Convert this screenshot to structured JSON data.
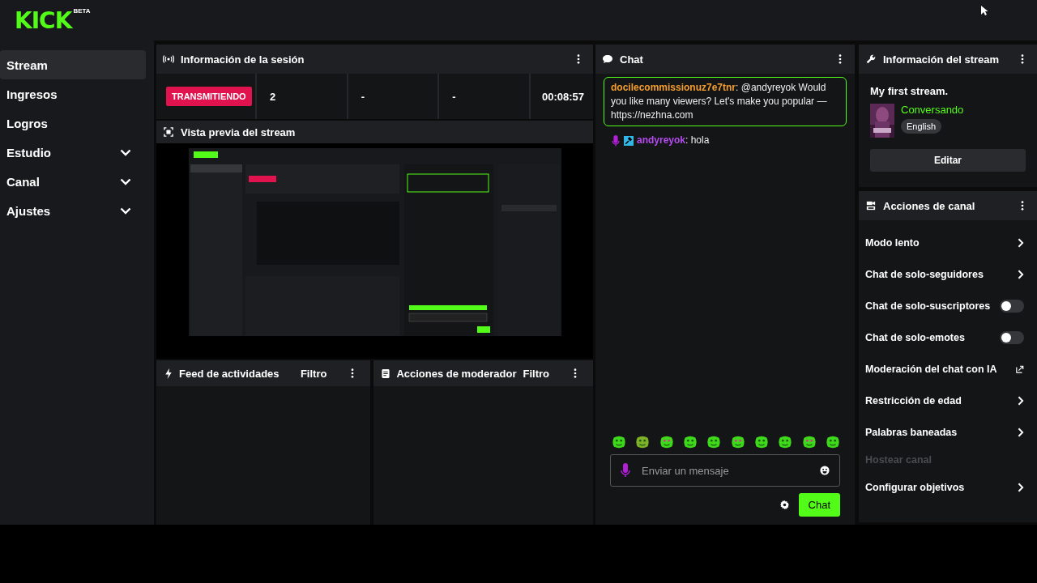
{
  "logo": {
    "text": "KICK",
    "badge": "BETA"
  },
  "sidebar": {
    "items": [
      {
        "label": "Stream",
        "selected": true,
        "expandable": false
      },
      {
        "label": "Ingresos",
        "selected": false,
        "expandable": false
      },
      {
        "label": "Logros",
        "selected": false,
        "expandable": false
      },
      {
        "label": "Estudio",
        "selected": false,
        "expandable": true
      },
      {
        "label": "Canal",
        "selected": false,
        "expandable": true
      },
      {
        "label": "Ajustes",
        "selected": false,
        "expandable": true
      }
    ]
  },
  "session": {
    "title": "Información de la sesión",
    "status": "TRANSMITIENDO",
    "stats": [
      "2",
      "-",
      "-",
      "00:08:57"
    ]
  },
  "preview": {
    "title": "Vista previa del stream",
    "kind": "picture"
  },
  "activity_feed": {
    "title": "Feed de actividades",
    "filter": "Filtro"
  },
  "mod_actions": {
    "title": "Acciones de moderador",
    "filter": "Filtro"
  },
  "chat": {
    "title": "Chat",
    "messages": [
      {
        "user": "docilecommissionuz7e7tnr",
        "color": "#f59e2b",
        "text": ": @andyreyok Would you like many viewers? Let's make you popular — https://nezhna.com",
        "highlighted": true,
        "badges": false
      },
      {
        "user": "andyreyok",
        "color": "#b44cf0",
        "text": ": hola",
        "highlighted": false,
        "badges": true
      }
    ],
    "input": {
      "placeholder": "Enviar un mensaje"
    },
    "send": "Chat"
  },
  "stream_info": {
    "title": "Información del stream",
    "stream_title": "My first stream.",
    "category": "Conversando",
    "tag": "English",
    "edit": "Editar"
  },
  "channel_actions": {
    "title": "Acciones de canal",
    "items": [
      {
        "label": "Modo lento",
        "kind": "chevron",
        "disabled": false
      },
      {
        "label": "Chat de solo-seguidores",
        "kind": "chevron",
        "disabled": false
      },
      {
        "label": "Chat de solo-suscriptores",
        "kind": "toggle",
        "on": false,
        "disabled": false
      },
      {
        "label": "Chat de solo-emotes",
        "kind": "toggle",
        "on": false,
        "disabled": false
      },
      {
        "label": "Moderación del chat con IA",
        "kind": "external",
        "disabled": false
      },
      {
        "label": "Restricción de edad",
        "kind": "chevron",
        "disabled": false
      },
      {
        "label": "Palabras baneadas",
        "kind": "chevron",
        "disabled": false
      },
      {
        "label": "Hostear canal",
        "kind": "plain",
        "disabled": true
      },
      {
        "label": "Configurar objetivos",
        "kind": "chevron",
        "disabled": false
      }
    ]
  }
}
